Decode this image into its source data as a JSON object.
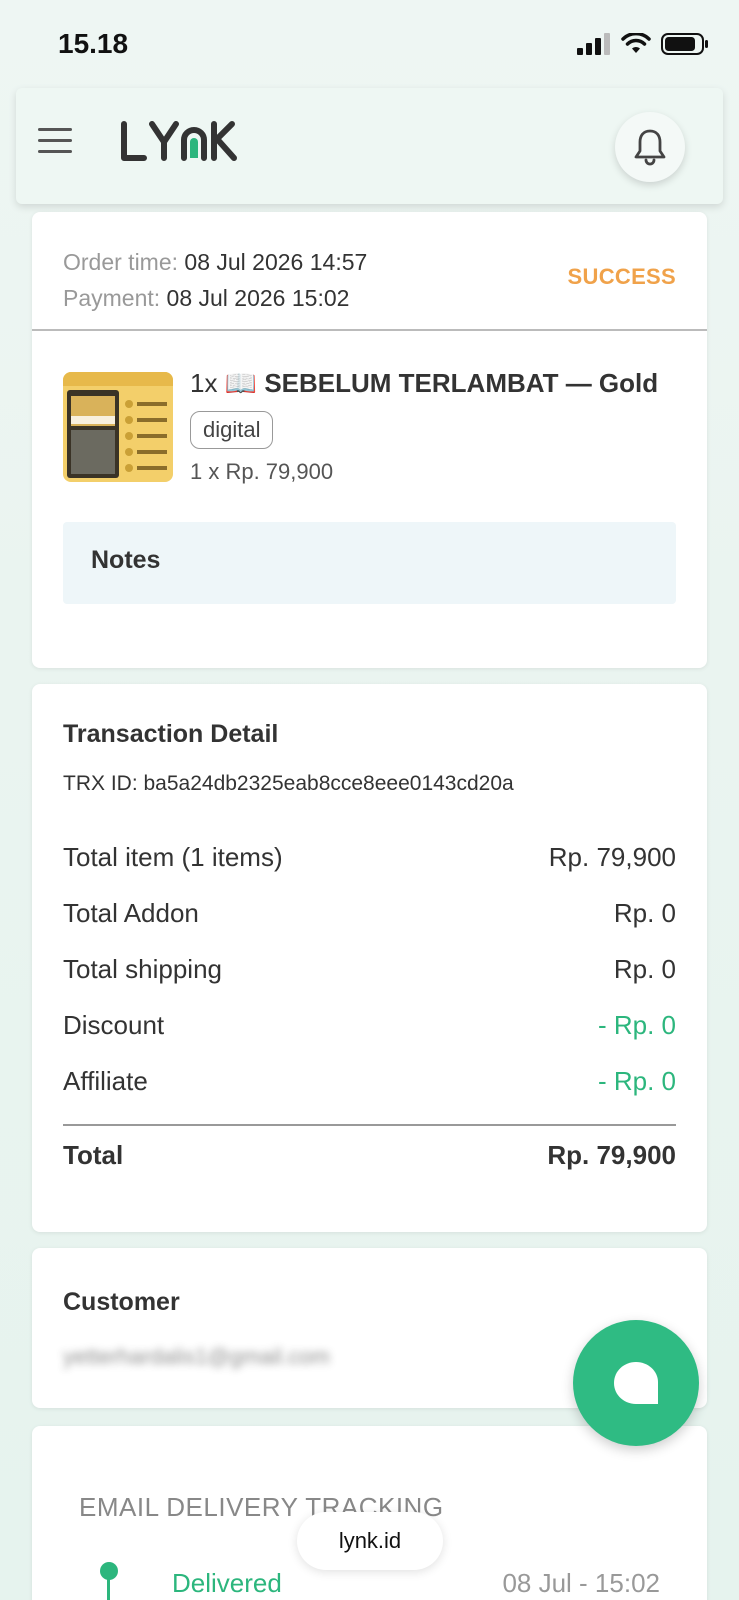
{
  "status_bar": {
    "time": "15.18"
  },
  "header": {
    "brand": "LYNK",
    "menu_icon": "hamburger-icon",
    "bell_icon": "bell-icon"
  },
  "order": {
    "order_time_label": "Order time:",
    "order_time": "08 Jul 2026 14:57",
    "payment_label": "Payment:",
    "payment_time": "08 Jul 2026 15:02",
    "status": "SUCCESS",
    "status_color": "#f0a24a",
    "product": {
      "qty_prefix": "1x",
      "emoji": "📖",
      "name": "SEBELUM TERLAMBAT — Gold",
      "tag": "digital",
      "price_line": "1 x Rp. 79,900"
    },
    "notes_label": "Notes"
  },
  "transaction": {
    "title": "Transaction Detail",
    "trx_id": "TRX ID: ba5a24db2325eab8cce8eee0143cd20a",
    "rows": [
      {
        "label": "Total item (1 items)",
        "value": "Rp. 79,900"
      },
      {
        "label": "Total Addon",
        "value": "Rp. 0"
      },
      {
        "label": "Total shipping",
        "value": "Rp. 0"
      },
      {
        "label": "Discount",
        "value": "- Rp. 0"
      },
      {
        "label": "Affiliate",
        "value": "- Rp. 0"
      }
    ],
    "total_label": "Total",
    "total_value": "Rp. 79,900",
    "accent_green": "#2cb67d"
  },
  "customer": {
    "title": "Customer",
    "email": "yetterhardalis1@gmail.com"
  },
  "tracking": {
    "title": "EMAIL DELIVERY TRACKING",
    "status": "Delivered",
    "time": "08 Jul - 15:02"
  },
  "browser": {
    "url": "lynk.id"
  },
  "chat_icon": "chat-bubble-icon"
}
